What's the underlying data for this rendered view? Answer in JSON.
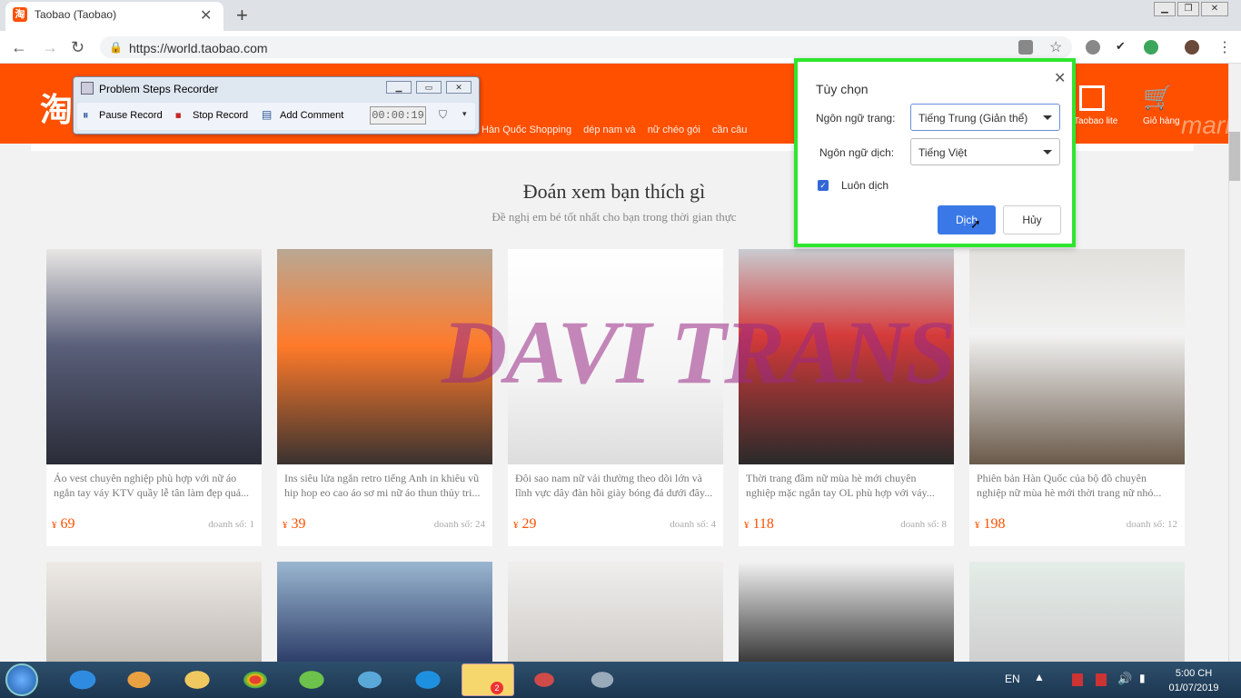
{
  "browser": {
    "tab_title": "Taobao (Taobao)",
    "url": "https://world.taobao.com",
    "new_tab_symbol": "+",
    "close_symbol": "✕"
  },
  "taobao": {
    "logo_char": "淘",
    "category_links": [
      "Hàn Quốc Shopping",
      "dép nam và",
      "nữ chéo gói",
      "cần câu"
    ],
    "taobao_lite_label": "Taobao lite",
    "cart_label": "Giỏ hàng",
    "mark_text": "mark"
  },
  "section": {
    "title": "Đoán xem bạn thích gì",
    "subtitle": "Đề nghị em bé tốt nhất cho bạn trong thời gian thực"
  },
  "products": [
    {
      "desc": "Áo vest chuyên nghiệp phù hợp với nữ áo ngắn tay váy KTV quầy lễ tân làm đẹp quả...",
      "currency": "¥",
      "price": "69",
      "sales": "doanh số: 1",
      "img_color": "#5a5f7a"
    },
    {
      "desc": "Ins siêu lửa ngắn retro tiếng Anh in khiêu vũ hip hop eo cao áo sơ mi nữ áo thun thủy tri...",
      "currency": "¥",
      "price": "39",
      "sales": "doanh số: 24",
      "img_color": "#c98a5a"
    },
    {
      "desc": "Đôi sao nam nữ vải thường theo dõi lớn và lĩnh vực dây đàn hồi giày bóng đá dưới đây...",
      "currency": "¥",
      "price": "29",
      "sales": "doanh số: 4",
      "img_color": "#e8e8e8"
    },
    {
      "desc": "Thời trang đầm nữ mùa hè mới chuyên nghiệp mặc ngắn tay OL phù hợp với váy...",
      "currency": "¥",
      "price": "118",
      "sales": "doanh số: 8",
      "img_color": "#8a8f95"
    },
    {
      "desc": "Phiên bản Hàn Quốc của bộ đồ chuyên nghiệp nữ mùa hè mới thời trang nữ nhỏ...",
      "currency": "¥",
      "price": "198",
      "sales": "doanh số: 12",
      "img_color": "#b0aca5"
    }
  ],
  "products_row2": [
    {
      "img_color": "#d8d4d0"
    },
    {
      "img_color": "#6a86a8"
    },
    {
      "img_color": "#e4e2e0"
    },
    {
      "img_color": "#cfcdcb"
    },
    {
      "img_color": "#dcdad8"
    }
  ],
  "watermark": "DAVI TRANS",
  "psr": {
    "title": "Problem Steps Recorder",
    "pause_label": "Pause Record",
    "stop_label": "Stop Record",
    "comment_label": "Add Comment",
    "timer": "00:00:19"
  },
  "translate_popup": {
    "title": "Tùy chọn",
    "page_lang_label": "Ngôn ngữ trang:",
    "page_lang_value": "Tiếng Trung (Giản thể)",
    "target_lang_label": "Ngôn ngữ dịch:",
    "target_lang_value": "Tiếng Việt",
    "always_translate_label": "Luôn dịch",
    "always_translate_checked": true,
    "translate_button": "Dịch",
    "cancel_button": "Hủy",
    "highlight_color": "#2ee62e",
    "button_color": "#3b78e7"
  },
  "taskbar": {
    "language": "EN",
    "time": "5:00 CH",
    "date": "01/07/2019",
    "zalo_badge": "2"
  },
  "colors": {
    "taobao_orange": "#ff5000"
  }
}
